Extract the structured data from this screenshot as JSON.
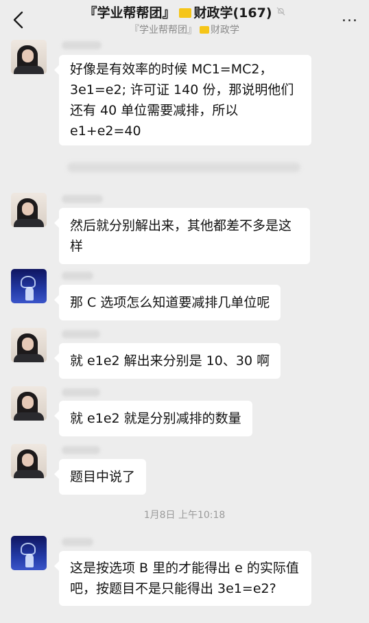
{
  "header": {
    "title_group": "『学业帮帮团』",
    "title_topic": "财政学(167)",
    "subtitle_group": "『学业帮帮团』",
    "subtitle_topic": "财政学",
    "more_label": "..."
  },
  "messages": [
    {
      "sender": "girl",
      "text": "好像是有效率的时候 MC1=MC2，3e1=e2; 许可证 140 份，那说明他们还有 40 单位需要减排，所以 e1+e2=40"
    },
    {
      "sender": "girl",
      "text": "然后就分别解出来，其他都差不多是这样"
    },
    {
      "sender": "blue",
      "text": "那 C 选项怎么知道要减排几单位呢"
    },
    {
      "sender": "girl",
      "text": "就 e1e2 解出来分别是 10、30 啊"
    },
    {
      "sender": "girl",
      "text": "就 e1e2 就是分别减排的数量"
    },
    {
      "sender": "girl",
      "text": "题目中说了"
    },
    {
      "sender": "blue",
      "text": "这是按选项 B 里的才能得出 e 的实际值吧，按题目不是只能得出 3e1=e2?"
    }
  ],
  "timestamp": "1月8日 上午10:18",
  "colors": {
    "background": "#ededed",
    "bubble": "#ffffff",
    "folder_icon": "#f5c518"
  }
}
